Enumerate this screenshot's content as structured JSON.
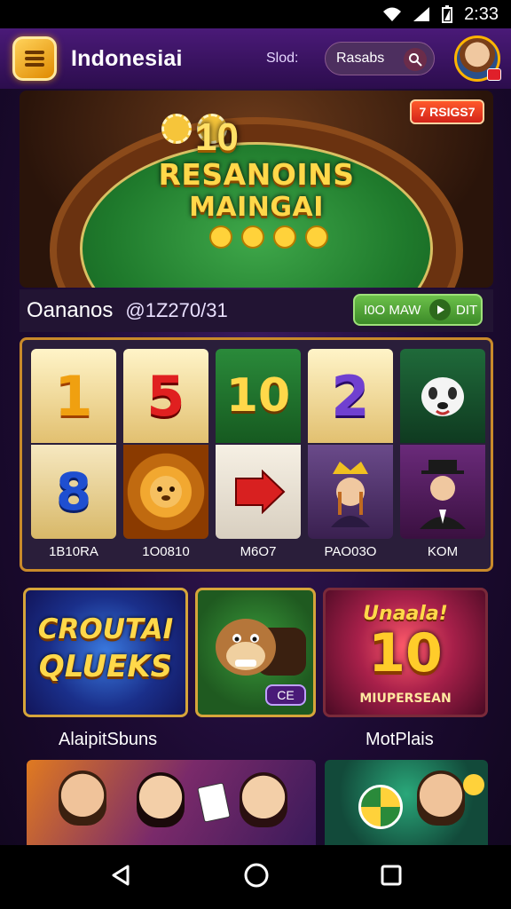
{
  "status_bar": {
    "time": "2:33"
  },
  "header": {
    "title": "Indonesiai",
    "slot_label": "Slod:",
    "search_text": "Rasabs"
  },
  "hero": {
    "number": "10",
    "title_line1": "RESANOINS",
    "title_line2": "MAINGAI",
    "badge": "7 RSIGS7"
  },
  "info": {
    "title": "Oananos",
    "code": "@1Z270/31",
    "cta_left": "I0O MAW",
    "cta_right": "DIT"
  },
  "reels": [
    {
      "top": "1",
      "bottom": "8",
      "label": "1B10RA"
    },
    {
      "top": "5",
      "bottom": "lion",
      "label": "1O0810"
    },
    {
      "top": "10",
      "bottom": "arrow",
      "label": "M6O7"
    },
    {
      "top": "2",
      "bottom": "queen",
      "label": "PAO03O"
    },
    {
      "top": "dog",
      "bottom": "man",
      "label": "KOM"
    }
  ],
  "tiles": [
    {
      "line1": "CROUTAI",
      "line2": "QLUEKS"
    },
    {
      "badge": "CE"
    },
    {
      "script": "Unaala!",
      "number": "10",
      "caption": "MIUPERSEAN"
    }
  ],
  "sections": {
    "left": "AlaipitSbuns",
    "right": "MotPlais"
  },
  "colors": {
    "accent_gold": "#ffd84a",
    "header_purple": "#4a1a78",
    "cta_green": "#4fa636"
  }
}
